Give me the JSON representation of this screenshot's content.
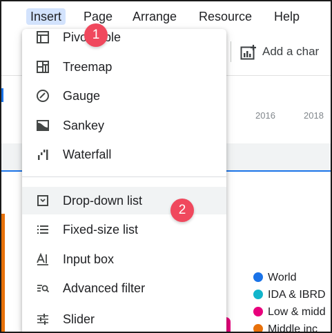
{
  "menubar": {
    "items": [
      {
        "label": "Insert"
      },
      {
        "label": "Page"
      },
      {
        "label": "Arrange"
      },
      {
        "label": "Resource"
      },
      {
        "label": "Help"
      }
    ]
  },
  "toolbar": {
    "add_chart_label": "Add a char"
  },
  "background": {
    "axis_labels": [
      "2016",
      "2018"
    ]
  },
  "dropdown": {
    "items": [
      {
        "label": "Pivot table",
        "icon": "pivot-table-icon"
      },
      {
        "label": "Treemap",
        "icon": "treemap-icon"
      },
      {
        "label": "Gauge",
        "icon": "gauge-icon"
      },
      {
        "label": "Sankey",
        "icon": "sankey-icon"
      },
      {
        "label": "Waterfall",
        "icon": "waterfall-icon"
      },
      {
        "label": "Drop-down list",
        "icon": "dropdown-list-icon"
      },
      {
        "label": "Fixed-size list",
        "icon": "fixed-size-list-icon"
      },
      {
        "label": "Input box",
        "icon": "input-box-icon"
      },
      {
        "label": "Advanced filter",
        "icon": "advanced-filter-icon"
      },
      {
        "label": "Slider",
        "icon": "slider-icon"
      }
    ]
  },
  "legend": {
    "items": [
      {
        "label": "World",
        "color": "#1a73e8"
      },
      {
        "label": "IDA & IBRD",
        "color": "#12b5cb"
      },
      {
        "label": "Low & midd",
        "color": "#e8007c"
      },
      {
        "label": "Middle inc",
        "color": "#e8710a"
      }
    ]
  },
  "badges": [
    {
      "label": "1"
    },
    {
      "label": "2"
    }
  ],
  "colors": {
    "accent": "#1a73e8",
    "badge": "#f0485d",
    "menu_active": "#d3e3fd"
  }
}
